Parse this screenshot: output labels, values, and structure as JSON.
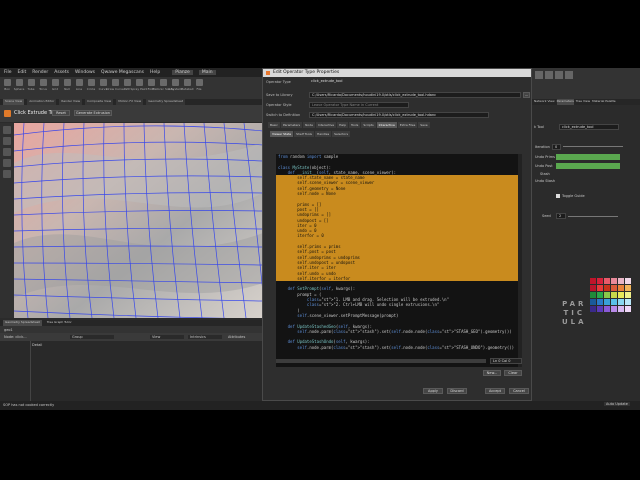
{
  "houdini": {
    "menu": [
      "File",
      "Edit",
      "Render",
      "Assets",
      "Windows",
      "Qwawe Megascans",
      "Help"
    ],
    "build_label": "Pianze",
    "mode_label": "Main",
    "shelf_tools": [
      "Box",
      "Sphere",
      "Tube",
      "Torus",
      "Grid",
      "Null",
      "Line",
      "Circle",
      "Curve",
      "Draw Curve",
      "Path",
      "Spray Paint",
      "Font",
      "Platonic Solids",
      "L-System",
      "Metaball",
      "File"
    ],
    "pane_tabs": [
      "Scene View",
      "Animation Editor",
      "Render View",
      "Composite View",
      "Motion FX View",
      "Geometry Spreadsheet"
    ],
    "tool_name": "Click Extrude Tool",
    "tool_buttons": [
      "Reset",
      "Generate Extrusion"
    ],
    "network_tabs": [
      "Geometry Spreadsheet",
      "Tree Graph Tutor"
    ],
    "network_path": "geo1",
    "node_label": "Node: click...",
    "network_filters": [
      "Group",
      "View",
      "Intrinsics",
      "Attributes"
    ],
    "network_column": "Detail",
    "status_text": "SOP has not cooked correctly",
    "right_tabs": [
      "Network View",
      "Parameters",
      "Tree View",
      "Material Palette"
    ]
  },
  "dialog": {
    "title": "Edit Operator Type Properties",
    "labels": {
      "operator_type": "Operator Type",
      "save_to_library": "Save to Library",
      "operator_style": "Operator Style",
      "switch_to_definition": "Switch to Definition"
    },
    "values": {
      "operator_type": "click_extrude_tool",
      "save_to_library": "C:/Users/Ricardo/Documents/houdini19.0/otls/click_extrude_tool.hdanc",
      "operator_style": "Leave Operator Type Name in Current",
      "switch_to_definition": "C:/Users/Ricardo/Documents/houdini19.0/otls/click_extrude_tool.hdanc"
    },
    "tabs": [
      "Basic",
      "Parameters",
      "Node",
      "Interactive",
      "Help",
      "Tools",
      "Scripts",
      "Interactive",
      "Extra Files",
      "Save"
    ],
    "sub_tabs": [
      "Viewer State",
      "Shelf Tools",
      "Handles",
      "Selectors"
    ],
    "code": [
      "from random import sample",
      "",
      "class MyState(object):",
      "    def __init__(self, state_name, scene_viewer):",
      "        self.state_name = state_name",
      "        self.scene_viewer = scene_viewer",
      "        self.geometry = None",
      "        self.node = None",
      "",
      "        prims = []",
      "        post = []",
      "        undoprims = []",
      "        undopost = []",
      "        iter = 0",
      "        undo = 0",
      "        iterfor = 0",
      "",
      "        self.prims = prims",
      "        self.post = post",
      "        self.undoprims = undoprims",
      "        self.undopost = undopost",
      "        self.iter = iter",
      "        self.undo = undo",
      "        self.iterfor = iterfor",
      "",
      "    def SetPrompt(self, kwargs):",
      "        prompt = (",
      "            \"1. LMB and drag. Selection will be extruded.\\n\"",
      "            \"2. Ctrl+LMB will undo single extrusions.\\n\"",
      "        )",
      "        self.scene_viewer.setPromptMessage(prompt)",
      "",
      "    def UpdateStashedGeo(self, kwargs):",
      "        self.node.parm(\"stash\").set(self.node.node(\"STASH_GEO\").geometry())",
      "",
      "    def UpdateStashUndo(self, kwargs):",
      "        self.node.parm(\"stash\").set(self.node.node(\"STASH_UNDO\").geometry())"
    ],
    "cursor_pos": "Ln 0 Col 0",
    "edit_buttons": [
      "New...",
      "Clear"
    ],
    "footer_buttons": [
      "Apply",
      "Discard",
      "Accept",
      "Cancel"
    ]
  },
  "params": {
    "tab_label": "k Tool",
    "name_value": "click_extrude_tool",
    "rows": [
      "Iteration",
      "Undo Prims",
      "Undo Post",
      "Stash",
      "Undo Stash"
    ],
    "toggle_label": "Toggle Guide",
    "seed_label": "Seed",
    "seed_value": "2",
    "iteration_value": "0"
  },
  "logo": [
    "PAR",
    "TIC",
    "ULA"
  ],
  "swatch_colors": [
    "#c0142a",
    "#d8213a",
    "#e85a6a",
    "#e88a9a",
    "#e8b5c5",
    "#f0d8e8",
    "#b9142a",
    "#e83a3a",
    "#c8321a",
    "#d85a3a",
    "#e8823a",
    "#f0b45a",
    "#208a3a",
    "#2aa84a",
    "#8ac84a",
    "#c8d84a",
    "#e8e85a",
    "#f0f08a",
    "#1a5a9a",
    "#2a7ac8",
    "#3aa0d8",
    "#5ac0e8",
    "#8ad8f0",
    "#b8e8f8",
    "#3a2a8a",
    "#5a3ab8",
    "#8a5ad8",
    "#b88ae8",
    "#d8b8f0",
    "#f0d8f8"
  ],
  "status": {
    "right_label": "Auto Update"
  }
}
